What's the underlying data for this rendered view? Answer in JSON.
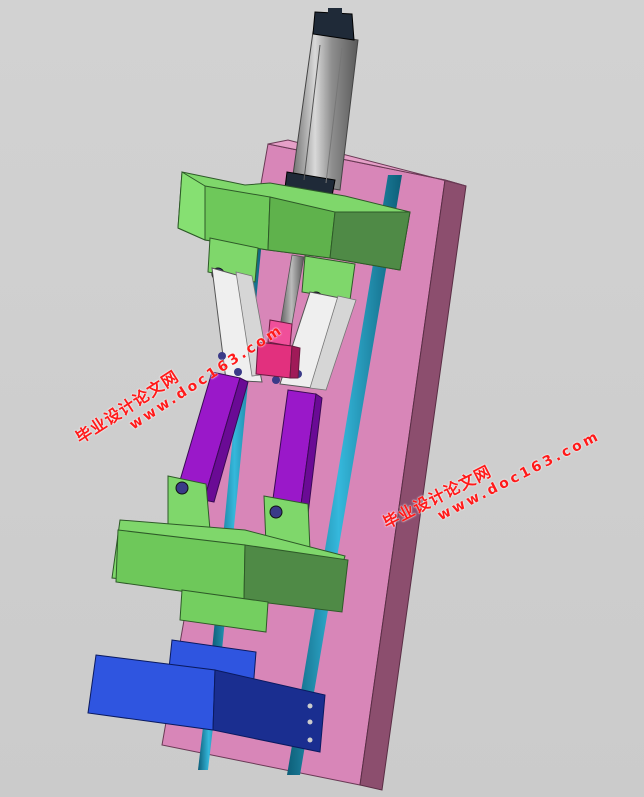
{
  "watermark": {
    "cn": "毕业设计论文网",
    "url": "www.doc163.com"
  },
  "colors": {
    "background": "#cccccc",
    "plate": "#d97fb4",
    "plate_side": "#8c4e6e",
    "block_top": "#7fd76b",
    "block_side": "#4f8a46",
    "rod": "#1a8fb0",
    "cylinder": "#a9a9a9",
    "link_silver": "#e8e8e8",
    "link_purple": "#9a18c9",
    "base_blue": "#2f55e0",
    "base_blue_dark": "#1a2e90",
    "pink_block": "#e2307e"
  }
}
